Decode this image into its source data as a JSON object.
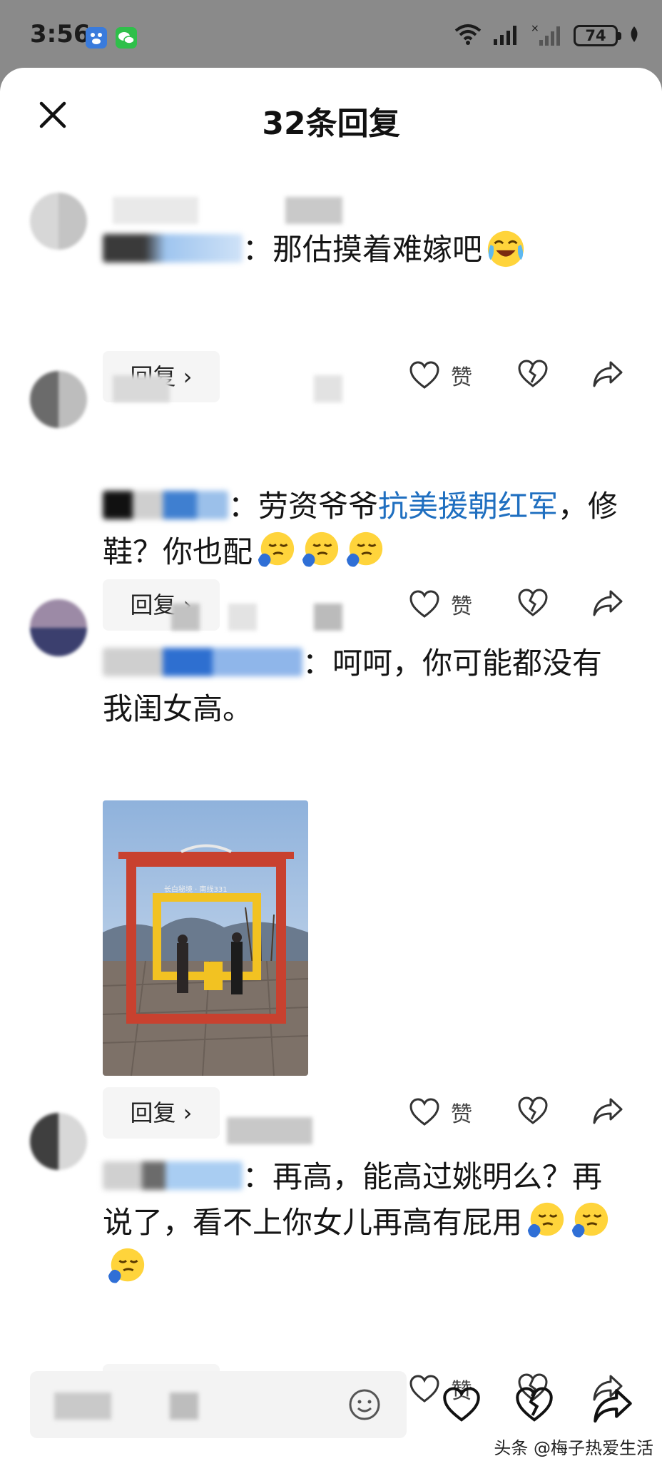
{
  "status_bar": {
    "time": "3:56",
    "battery": "74",
    "icons": [
      "baidu-app-icon",
      "wechat-app-icon",
      "wifi-icon",
      "signal-icon",
      "signal-off-icon",
      "battery-icon",
      "leaf-icon"
    ]
  },
  "sheet": {
    "title": "32条回复"
  },
  "actions": {
    "reply_label": "回复 ›",
    "like_label": "赞"
  },
  "comments": [
    {
      "text": "：那估摸着难嫁吧"
    },
    {
      "text_before_link": "：劳资爷爷",
      "link": "抗美援朝红军",
      "text_after_link": "，修鞋？你也配"
    },
    {
      "text": "：呵呵，你可能都没有我闺女高。",
      "photo_sign": "长白秘境 · 南线331"
    },
    {
      "text": "：再高，能高过姚明么？再说了，看不上你女儿再高有屁用"
    }
  ],
  "bottom_bar": {
    "icons": [
      "emoji-icon",
      "heart-icon",
      "broken-heart-icon",
      "share-icon"
    ]
  },
  "watermark": "头条 @梅子热爱生活",
  "colors": {
    "link": "#1f6fc0",
    "reply_bg": "#f5f5f5",
    "status_bg": "#8a8a8a"
  }
}
